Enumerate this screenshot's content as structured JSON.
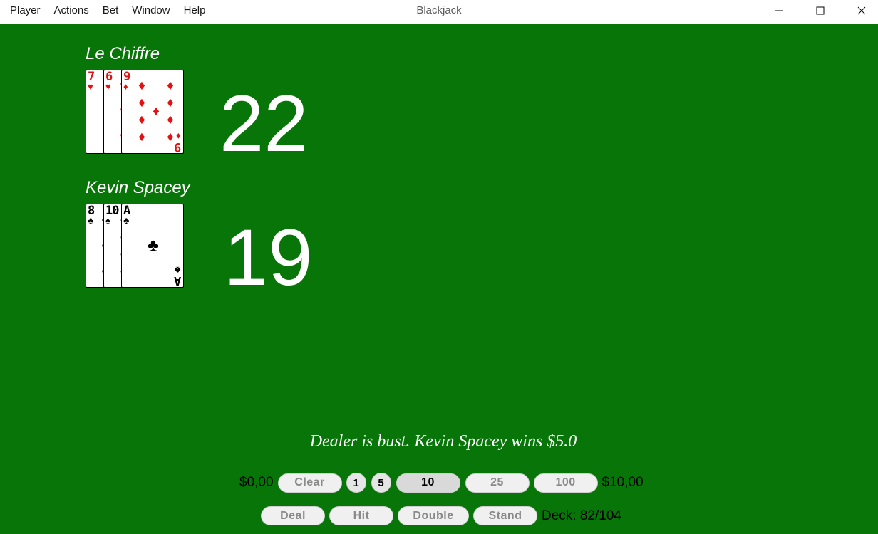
{
  "window": {
    "title": "Blackjack"
  },
  "menu": [
    "Player",
    "Actions",
    "Bet",
    "Window",
    "Help"
  ],
  "dealer": {
    "name": "Le Chiffre",
    "score": "22",
    "cards": [
      {
        "rank": "7",
        "suit": "♥",
        "color": "red"
      },
      {
        "rank": "6",
        "suit": "♥",
        "color": "red"
      },
      {
        "rank": "9",
        "suit": "♦",
        "color": "red"
      }
    ]
  },
  "player": {
    "name": "Kevin Spacey",
    "score": "19",
    "cards": [
      {
        "rank": "8",
        "suit": "♣",
        "color": "black"
      },
      {
        "rank": "10",
        "suit": "♠",
        "color": "black"
      },
      {
        "rank": "A",
        "suit": "♣",
        "color": "black"
      }
    ]
  },
  "message": "Dealer is bust. Kevin Spacey wins $5.0",
  "bet_bar": {
    "current_bet": "$0,00",
    "clear_label": "Clear",
    "chips": [
      "1",
      "5"
    ],
    "amounts": [
      "10",
      "25",
      "100"
    ],
    "selected_amount": "10",
    "balance": "$10,00"
  },
  "action_bar": {
    "deal_label": "Deal",
    "hit_label": "Hit",
    "double_label": "Double",
    "stand_label": "Stand",
    "deck_label": "Deck: 82/104"
  },
  "colors": {
    "table": "#087508",
    "red_suit": "#e21212"
  }
}
